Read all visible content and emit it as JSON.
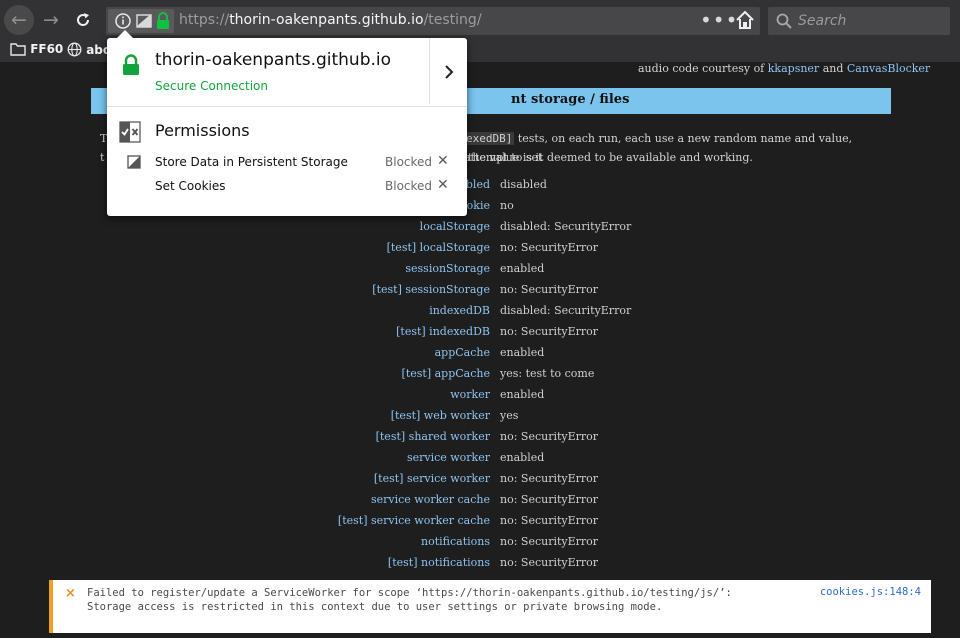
{
  "toolbar": {
    "url_prefix": "https://",
    "url_host": "thorin-oakenpants.github.io",
    "url_path": "/testing/",
    "search_placeholder": "Search",
    "page_actions": "•••"
  },
  "bookmarks": [
    "FF60",
    "abo"
  ],
  "page": {
    "credit_prefix": "audio code courtesy of",
    "credit_link1": "kkapsner",
    "credit_and": "and",
    "credit_link2": "CanvasBlocker",
    "banner_title": "nt storage / files",
    "intro_lead1": "T",
    "intro_code": "exedDB]",
    "intro_rest1": "tests, on each run, each use a new random name and value, attempt to set",
    "intro_lead2": "t",
    "intro_rest2": "the value is it deemed to be available and working.",
    "rows": [
      {
        "label": "abled",
        "value": "disabled"
      },
      {
        "label": "ookie",
        "value": "no"
      },
      {
        "label": "localStorage",
        "value": "disabled: SecurityError"
      },
      {
        "label": "[test] localStorage",
        "value": "no: SecurityError"
      },
      {
        "label": "sessionStorage",
        "value": "enabled"
      },
      {
        "label": "[test] sessionStorage",
        "value": "no: SecurityError"
      },
      {
        "label": "indexedDB",
        "value": "disabled: SecurityError"
      },
      {
        "label": "[test] indexedDB",
        "value": "no: SecurityError"
      },
      {
        "label": "appCache",
        "value": "enabled"
      },
      {
        "label": "[test] appCache",
        "value": "yes: test to come"
      },
      {
        "label": "worker",
        "value": "enabled"
      },
      {
        "label": "[test] web worker",
        "value": "yes"
      },
      {
        "label": "[test] shared worker",
        "value": "no: SecurityError"
      },
      {
        "label": "service worker",
        "value": "enabled"
      },
      {
        "label": "[test] service worker",
        "value": "no: SecurityError"
      },
      {
        "label": "service worker cache",
        "value": "no: SecurityError"
      },
      {
        "label": "[test] service worker cache",
        "value": "no: SecurityError"
      },
      {
        "label": "notifications",
        "value": "no: SecurityError"
      },
      {
        "label": "[test] notifications",
        "value": "no: SecurityError"
      }
    ]
  },
  "console": {
    "line1": "Failed to register/update a ServiceWorker for scope ‘https://thorin-oakenpants.github.io/testing/js/’:",
    "line2": "Storage access is restricted in this context due to user settings or private browsing mode.",
    "source": "cookies.js:148:4"
  },
  "popup": {
    "host": "thorin-oakenpants.github.io",
    "secure": "Secure Connection",
    "permissions_title": "Permissions",
    "permissions": [
      {
        "label": "Store Data in Persistent Storage",
        "state": "Blocked",
        "icon": "persistent-storage-icon"
      },
      {
        "label": "Set Cookies",
        "state": "Blocked",
        "icon": "none"
      }
    ]
  },
  "colors": {
    "secure_green": "#12a33b",
    "banner_blue": "#7ac4ee",
    "link_blue": "#8ec4f0",
    "warning_orange": "#f0a020"
  }
}
